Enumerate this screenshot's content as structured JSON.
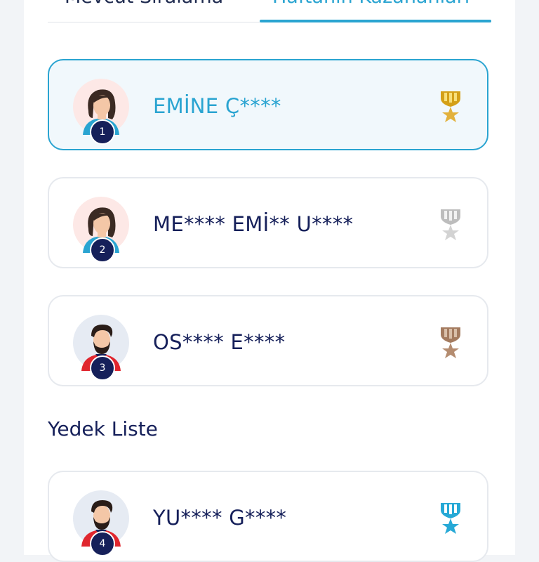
{
  "tabs": {
    "current_label": "Mevcut Sıralama",
    "winners_label": "Haftanın Kazananları",
    "active": "winners"
  },
  "winners": [
    {
      "rank": "1",
      "name": "EMİNE Ç****",
      "avatar": "woman-avatar",
      "medal": "gold-medal-icon",
      "highlighted": true
    },
    {
      "rank": "2",
      "name": "ME**** EMİ** U****",
      "avatar": "woman-avatar",
      "medal": "silver-medal-icon",
      "highlighted": false
    },
    {
      "rank": "3",
      "name": "OS**** E****",
      "avatar": "man-avatar",
      "medal": "bronze-medal-icon",
      "highlighted": false
    }
  ],
  "reserve": {
    "title": "Yedek Liste",
    "items": [
      {
        "rank": "4",
        "name": "YU**** G****",
        "avatar": "man-avatar",
        "medal": "blue-medal-icon"
      }
    ]
  },
  "colors": {
    "accent": "#2aa4d1",
    "navy": "#16205a",
    "gold": "#d4a017",
    "silver": "#c9c9c9",
    "bronze": "#a47b5f",
    "blue_medal": "#27a9d6"
  }
}
